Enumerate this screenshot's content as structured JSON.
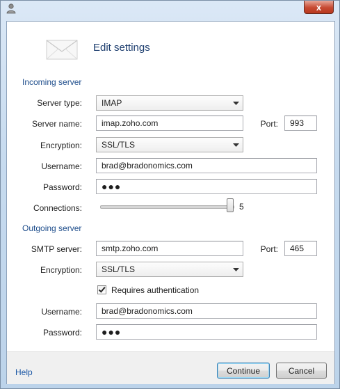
{
  "window": {
    "close_glyph": "x",
    "app_icon": "user-icon"
  },
  "header": {
    "title": "Edit settings",
    "icon": "envelope-icon"
  },
  "incoming": {
    "section_title": "Incoming server",
    "server_type_label": "Server type:",
    "server_type_value": "IMAP",
    "server_name_label": "Server name:",
    "server_name_value": "imap.zoho.com",
    "port_label": "Port:",
    "port_value": "993",
    "encryption_label": "Encryption:",
    "encryption_value": "SSL/TLS",
    "username_label": "Username:",
    "username_value": "brad@bradonomics.com",
    "password_label": "Password:",
    "password_value": "●●●",
    "connections_label": "Connections:",
    "connections_value": "5"
  },
  "outgoing": {
    "section_title": "Outgoing server",
    "smtp_label": "SMTP server:",
    "smtp_value": "smtp.zoho.com",
    "port_label": "Port:",
    "port_value": "465",
    "encryption_label": "Encryption:",
    "encryption_value": "SSL/TLS",
    "requires_auth_label": "Requires authentication",
    "requires_auth_checked": true,
    "username_label": "Username:",
    "username_value": "brad@bradonomics.com",
    "password_label": "Password:",
    "password_value": "●●●"
  },
  "footer": {
    "help_label": "Help",
    "continue_label": "Continue",
    "cancel_label": "Cancel"
  },
  "colors": {
    "section_title": "#1f4e8c",
    "link": "#1b57a5",
    "close_button": "#c74a32"
  }
}
